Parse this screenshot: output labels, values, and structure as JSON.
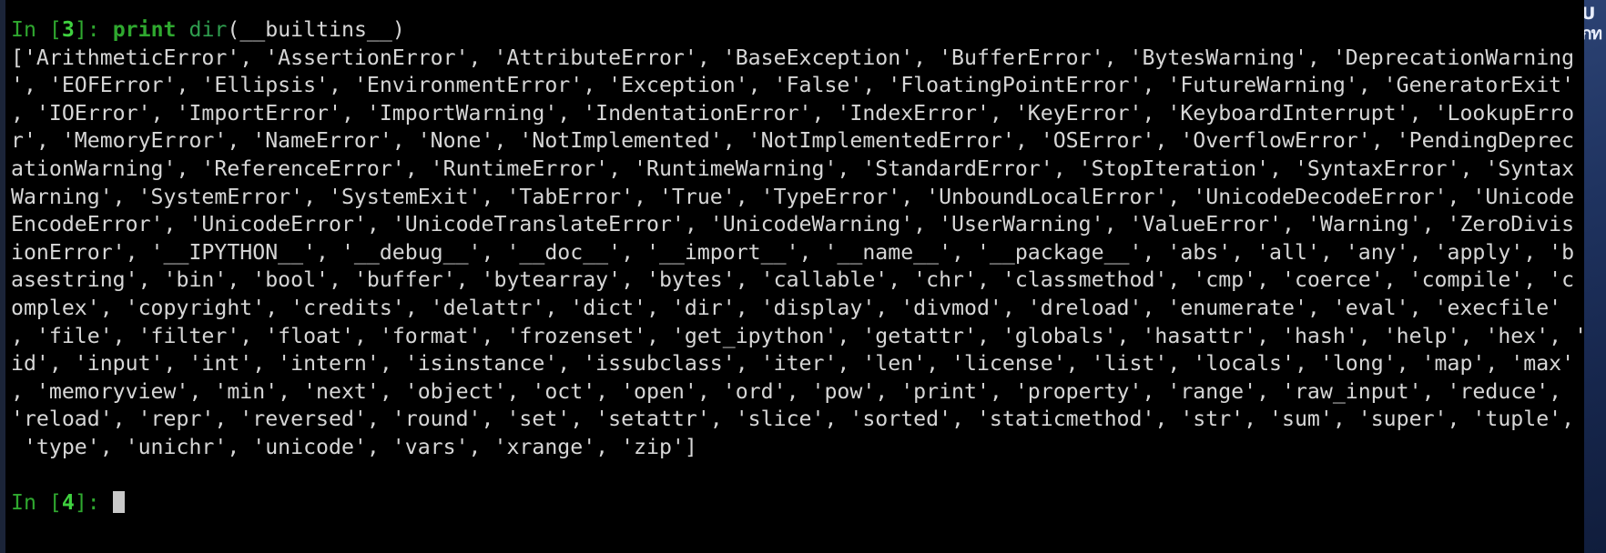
{
  "window": {
    "title": "ipython-terminal",
    "background_color": "#000000",
    "foreground_color": "#d6d6d6",
    "accent_green": "#2fa82f",
    "border_color": "#1b2438"
  },
  "background_window": {
    "visible_glyphs": "U\nกท"
  },
  "terminal": {
    "prompt": {
      "label_in": "In [",
      "number": "3",
      "label_close": "]: ",
      "keyword": "print",
      "space": " ",
      "function": "dir",
      "arguments": "(__builtins__)",
      "full_command": "In [3]: print dir(__builtins__)"
    },
    "next_prompt": {
      "label_in": "In [",
      "number": "4",
      "label_close": "]: ",
      "cursor": "block"
    },
    "output_lines": [
      "['ArithmeticError', 'AssertionError', 'AttributeError', 'BaseException', 'BufferError', 'BytesWarning', 'DeprecationWarning",
      "', 'EOFError', 'Ellipsis', 'EnvironmentError', 'Exception', 'False', 'FloatingPointError', 'FutureWarning', 'GeneratorExit'",
      ", 'IOError', 'ImportError', 'ImportWarning', 'IndentationError', 'IndexError', 'KeyError', 'KeyboardInterrupt', 'LookupErro",
      "r', 'MemoryError', 'NameError', 'None', 'NotImplemented', 'NotImplementedError', 'OSError', 'OverflowError', 'PendingDeprec",
      "ationWarning', 'ReferenceError', 'RuntimeError', 'RuntimeWarning', 'StandardError', 'StopIteration', 'SyntaxError', 'Syntax",
      "Warning', 'SystemError', 'SystemExit', 'TabError', 'True', 'TypeError', 'UnboundLocalError', 'UnicodeDecodeError', 'Unicode",
      "EncodeError', 'UnicodeError', 'UnicodeTranslateError', 'UnicodeWarning', 'UserWarning', 'ValueError', 'Warning', 'ZeroDivis",
      "ionError', '__IPYTHON__', '__debug__', '__doc__', '__import__', '__name__', '__package__', 'abs', 'all', 'any', 'apply', 'b",
      "asestring', 'bin', 'bool', 'buffer', 'bytearray', 'bytes', 'callable', 'chr', 'classmethod', 'cmp', 'coerce', 'compile', 'c",
      "omplex', 'copyright', 'credits', 'delattr', 'dict', 'dir', 'display', 'divmod', 'dreload', 'enumerate', 'eval', 'execfile'",
      ", 'file', 'filter', 'float', 'format', 'frozenset', 'get_ipython', 'getattr', 'globals', 'hasattr', 'hash', 'help', 'hex', '",
      "id', 'input', 'int', 'intern', 'isinstance', 'issubclass', 'iter', 'len', 'license', 'list', 'locals', 'long', 'map', 'max'",
      ", 'memoryview', 'min', 'next', 'object', 'oct', 'open', 'ord', 'pow', 'print', 'property', 'range', 'raw_input', 'reduce',",
      "'reload', 'repr', 'reversed', 'round', 'set', 'setattr', 'slice', 'sorted', 'staticmethod', 'str', 'sum', 'super', 'tuple',",
      " 'type', 'unichr', 'unicode', 'vars', 'xrange', 'zip']"
    ]
  }
}
